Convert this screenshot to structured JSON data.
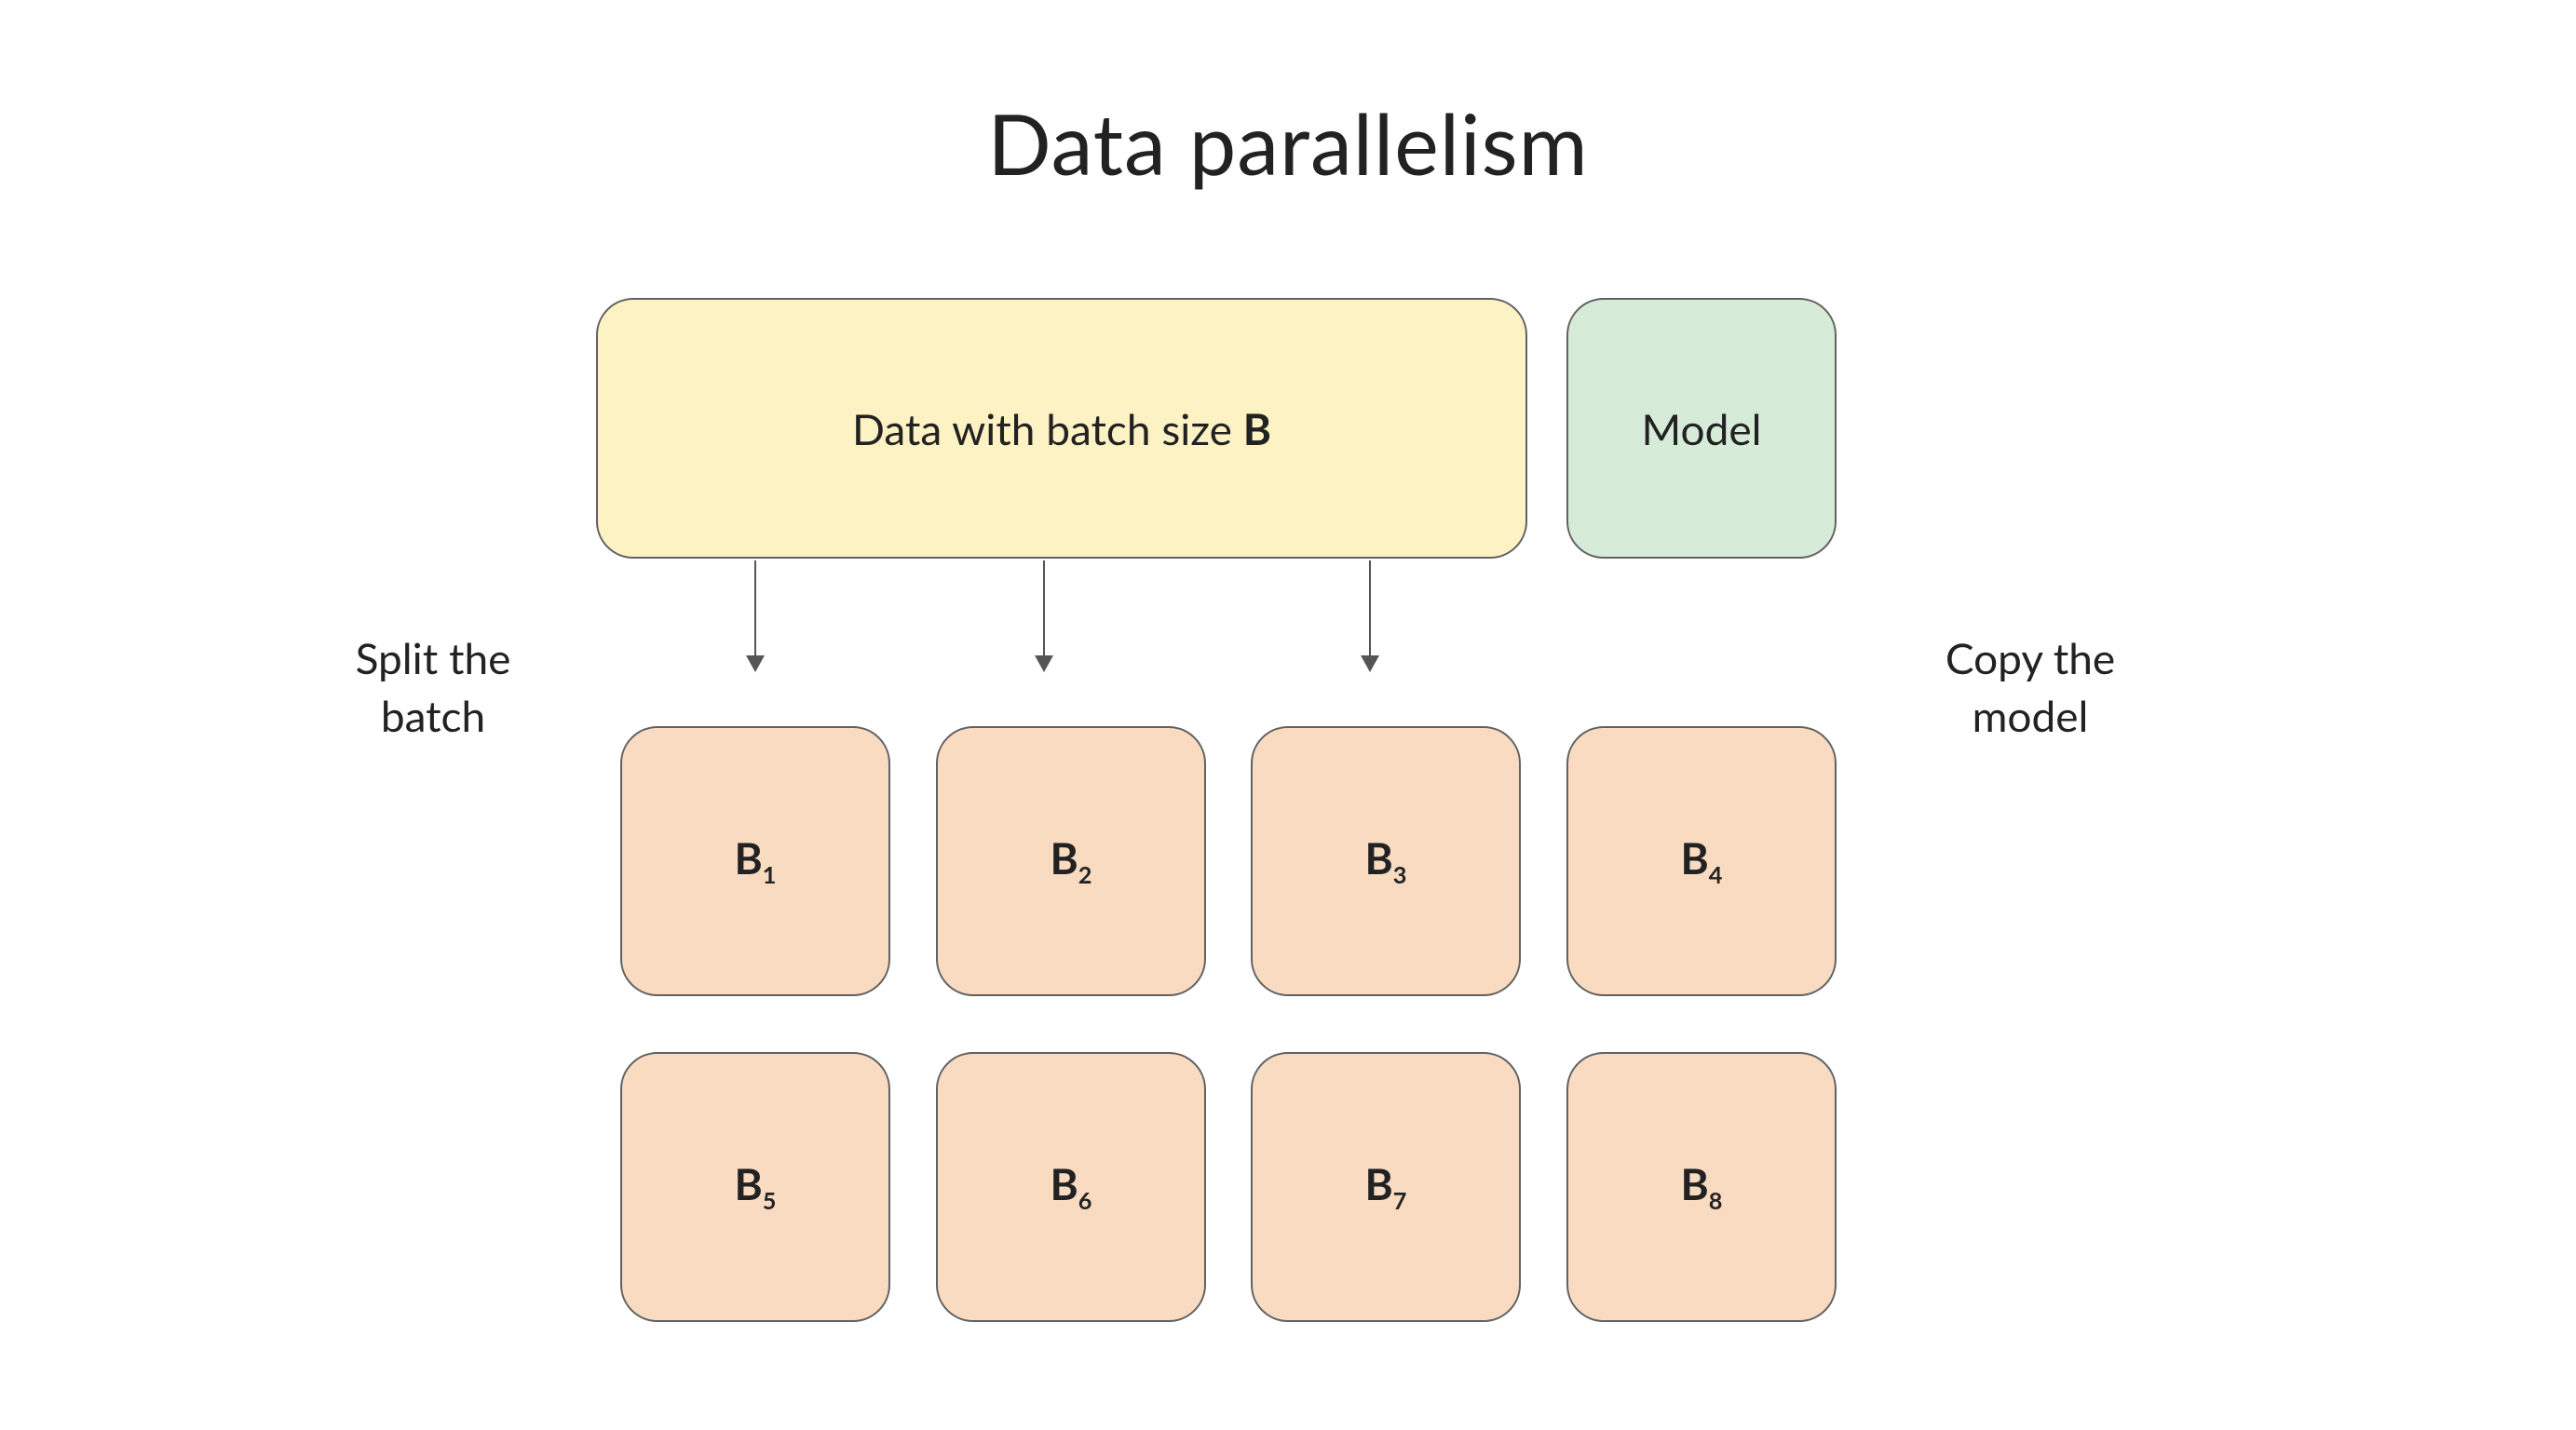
{
  "title": "Data parallelism",
  "data_box_prefix": "Data with batch size ",
  "data_box_bold": "B",
  "model_box": "Model",
  "left_label_l1": "Split the",
  "left_label_l2": "batch",
  "right_label_l1": "Copy the",
  "right_label_l2": "model",
  "batch_letter": "B",
  "batches": [
    "1",
    "2",
    "3",
    "4",
    "5",
    "6",
    "7",
    "8"
  ]
}
